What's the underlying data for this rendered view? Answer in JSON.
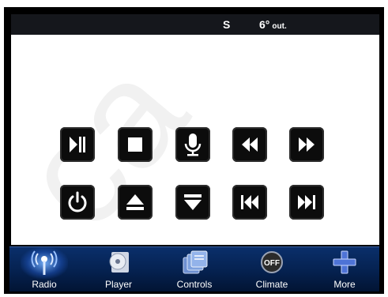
{
  "status": {
    "compass": "S",
    "temp": "6°",
    "temp_suffix": "out."
  },
  "watermark": "ca",
  "media_buttons": [
    {
      "name": "play-pause-button",
      "icon": "play-pause-icon"
    },
    {
      "name": "stop-button",
      "icon": "stop-icon"
    },
    {
      "name": "voice-button",
      "icon": "microphone-icon"
    },
    {
      "name": "rewind-button",
      "icon": "rewind-icon"
    },
    {
      "name": "fast-forward-button",
      "icon": "fast-forward-icon"
    },
    {
      "name": "power-button",
      "icon": "power-icon"
    },
    {
      "name": "eject-button",
      "icon": "eject-icon"
    },
    {
      "name": "insert-button",
      "icon": "insert-icon"
    },
    {
      "name": "previous-track-button",
      "icon": "previous-track-icon"
    },
    {
      "name": "next-track-button",
      "icon": "next-track-icon"
    }
  ],
  "nav": {
    "radio": "Radio",
    "player": "Player",
    "controls": "Controls",
    "climate": "Climate",
    "climate_badge": "OFF",
    "more": "More",
    "active": "radio"
  }
}
